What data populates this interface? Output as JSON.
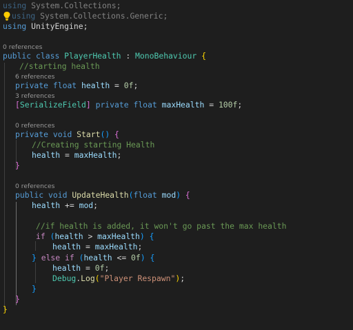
{
  "using_lines": {
    "l1": {
      "kw": "using",
      "ns": "System.Collections;"
    },
    "l2": {
      "kw": "using",
      "ns": "System.Collections.Generic;"
    },
    "l3": {
      "kw": "using",
      "ns": "UnityEngine;"
    }
  },
  "codelens": {
    "class_refs": "0 references",
    "health_refs": "6 references",
    "maxhealth_refs": "3 references",
    "start_refs": "0 references",
    "update_refs": "0 references"
  },
  "class_decl": {
    "public": "public",
    "class": "class",
    "name": "PlayerHealth",
    "colon": " : ",
    "base": "MonoBehaviour",
    "brace": "{"
  },
  "comments": {
    "starting_health": "//starting health",
    "creating": "//Creating starting Health",
    "added": "//if health is added, it won't go past the max health"
  },
  "field_health": {
    "private": "private",
    "float": "float",
    "name": "health",
    "eq": " = ",
    "value": "0f",
    "semi": ";"
  },
  "field_max": {
    "open": "[",
    "attr": "SerializeField",
    "close": "]",
    "private": "private",
    "float": "float",
    "name": "maxHealth",
    "eq": " = ",
    "value": "100f",
    "semi": ";"
  },
  "start_method": {
    "private": "private",
    "void": "void",
    "name": "Start",
    "parens": "()",
    "brace": "{",
    "body_lhs": "health",
    "body_eq": " = ",
    "body_rhs": "maxHealth",
    "body_semi": ";",
    "close": "}"
  },
  "update_method": {
    "public": "public",
    "void": "void",
    "name": "UpdateHealth",
    "open_paren": "(",
    "param_type": "float",
    "param_name": "mod",
    "close_paren": ")",
    "brace": "{",
    "add_lhs": "health",
    "add_op": " += ",
    "add_rhs": "mod",
    "add_semi": ";",
    "close": "}"
  },
  "if_block": {
    "if": "if",
    "open": "(",
    "lhs": "health",
    "op": " > ",
    "rhs": "maxHealth",
    "close": ")",
    "brace": "{",
    "assign_lhs": "health",
    "assign_eq": " = ",
    "assign_rhs": "maxHealth",
    "assign_semi": ";"
  },
  "elseif_block": {
    "rbrace": "}",
    "else": "else",
    "if": "if",
    "open": "(",
    "lhs": "health",
    "op": " <= ",
    "value": "0f",
    "close": ")",
    "brace": "{",
    "assign_lhs": "health",
    "assign_eq": " = ",
    "assign_value": "0f",
    "assign_semi": ";",
    "debug": "Debug",
    "dot": ".",
    "log": "Log",
    "lp": "(",
    "msg": "\"Player Respawn\"",
    "rp": ")",
    "semi": ";",
    "end": "}"
  },
  "class_close": "}"
}
